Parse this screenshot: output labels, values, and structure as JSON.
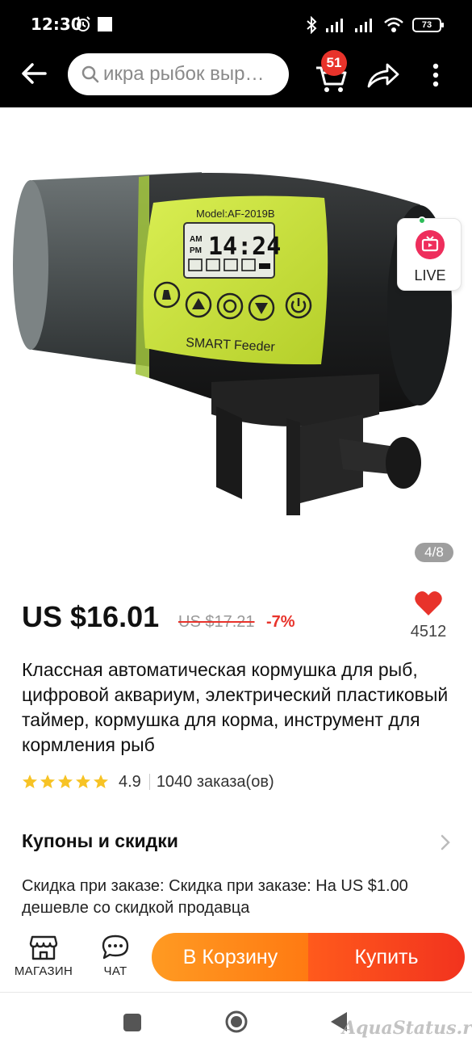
{
  "status_bar": {
    "time": "12:30",
    "battery": "73"
  },
  "header": {
    "search_placeholder": "икра рыбок выр…",
    "cart_count": "51"
  },
  "gallery": {
    "counter": "4/8",
    "live_label": "LIVE",
    "product_image": {
      "model_label": "Model:AF-2019B",
      "display_am": "AM",
      "display_pm": "PM",
      "display_time": "14:24",
      "brand_label": "SMART Feeder"
    }
  },
  "product": {
    "price": "US $16.01",
    "old_price": "US $17.21",
    "discount": "-7%",
    "likes": "4512",
    "title": "Классная автоматическая кормушка для рыб, цифровой аквариум, электрический пластиковый таймер, кормушка для корма, инструмент для кормления рыб",
    "rating": "4.9",
    "stars": 5,
    "orders": "1040 заказа(ов)"
  },
  "coupons": {
    "title": "Купоны и скидки",
    "text": "Скидка при заказе: Скидка при заказе: На US $1.00 дешевле со скидкой продавца"
  },
  "actions": {
    "store_label": "МАГАЗИН",
    "chat_label": "ЧАТ",
    "add_to_cart": "В Корзину",
    "buy": "Купить"
  },
  "watermark": "AquaStatus.ru",
  "colors": {
    "accent_red": "#e8332b",
    "cart_orange": "#ff8a1a",
    "buy_red": "#f43f1e",
    "star_yellow": "#f7c325",
    "device_green": "#c8e03a"
  }
}
